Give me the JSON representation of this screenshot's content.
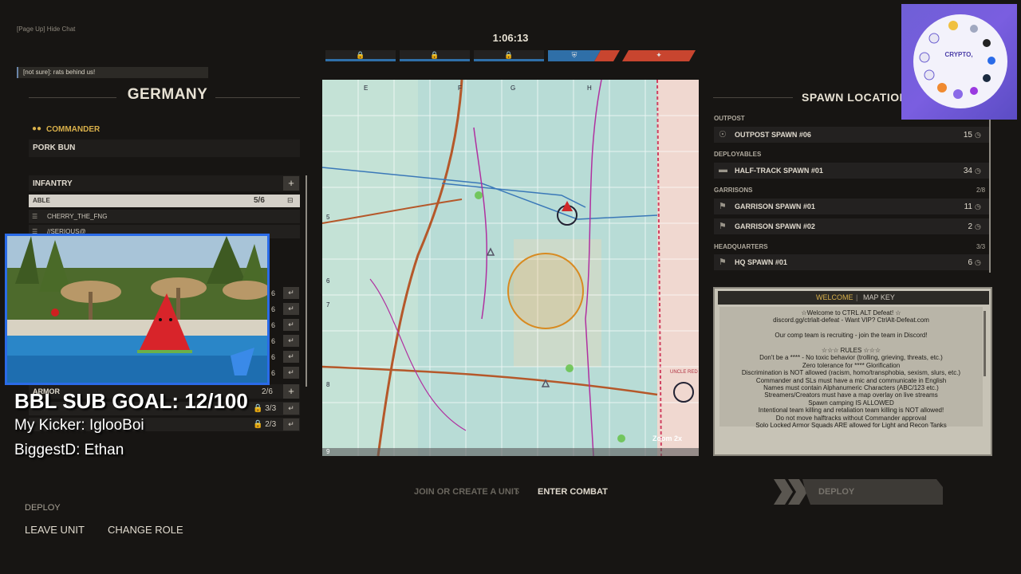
{
  "chat": {
    "hint": "[Page Up] Hide Chat",
    "message": "[not sure]: rats behind us!"
  },
  "timer": "1:06:13",
  "strongpoint_icons": [
    "lock-icon",
    "lock-icon",
    "lock-icon",
    "shield-icon",
    "flash-icon"
  ],
  "colors": {
    "allies": "#2f6fa8",
    "axis": "#c8452f",
    "accent": "#d9b04a",
    "stream_border": "#2a6be8"
  },
  "left_panel": {
    "faction": "GERMANY",
    "commander_label": "COMMANDER",
    "commander_name": "PORK BUN",
    "infantry_label": "INFANTRY",
    "squad": {
      "name": "ABLE",
      "count": "5/6"
    },
    "members": [
      "CHERRY_THE_FNG",
      "//SERIOUS@"
    ],
    "squad_counts": [
      "6",
      "6",
      "6",
      "6",
      "6",
      "6"
    ],
    "armor_label": "ARMOR",
    "armor_count": "2/6",
    "armor_squads": [
      "3/3",
      "2/3"
    ]
  },
  "overlay": {
    "sub_goal": "BBL SUB GOAL: 12/100",
    "kicker": "My Kicker: IglooBoi",
    "biggest": "BiggestD: Ethan"
  },
  "bottom_left": {
    "deploy": "DEPLOY",
    "leave_unit": "LEAVE UNIT",
    "change_role": "CHANGE ROLE"
  },
  "map": {
    "col_labels": [
      "E",
      "F",
      "G",
      "H"
    ],
    "row_labels": [
      "5",
      "6",
      "7",
      "8",
      "9"
    ],
    "place_labels": [
      "UNCLE RED"
    ],
    "zoom": "Zoom 2x"
  },
  "bottom_nav": {
    "step1": "JOIN OR CREATE A UNIT",
    "step2": "ENTER COMBAT",
    "deploy": "DEPLOY"
  },
  "spawns": {
    "title": "SPAWN LOCATIONS",
    "categories": [
      {
        "label": "OUTPOST",
        "count": "",
        "rows": [
          {
            "name": "OUTPOST SPAWN #06",
            "time": "15"
          }
        ]
      },
      {
        "label": "DEPLOYABLES",
        "count": "",
        "rows": [
          {
            "name": "HALF-TRACK SPAWN #01",
            "time": "34"
          }
        ]
      },
      {
        "label": "GARRISONS",
        "count": "2/8",
        "rows": [
          {
            "name": "GARRISON SPAWN #01",
            "time": "11"
          },
          {
            "name": "GARRISON SPAWN #02",
            "time": "2"
          }
        ]
      },
      {
        "label": "HEADQUARTERS",
        "count": "3/3",
        "rows": [
          {
            "name": "HQ SPAWN #01",
            "time": "6"
          }
        ]
      }
    ]
  },
  "info": {
    "tab_welcome": "WELCOME",
    "tab_mapkey": "MAP KEY",
    "lines": [
      "☆Welcome to CTRL ALT Defeat! ☆",
      "discord.gg/ctrlalt-defeat - Want VIP? CtrlAlt-Defeat.com",
      "",
      "Our comp team is recruiting - join the team in Discord!",
      "",
      "☆☆☆ RULES ☆☆☆",
      "Don't be a **** - No toxic behavior (trolling, grieving, threats, etc.)",
      "Zero tolerance for **** Glorification",
      "Discrimination is NOT allowed (racism, homo/transphobia, sexism, slurs, etc.)",
      "Commander and SLs must have a mic and communicate in English",
      "Names must contain Alphanumeric Characters (ABC/123 etc.)",
      "Streamers/Creators must have a map overlay on live streams",
      "Spawn camping IS ALLOWED",
      "Intentional team killing and retaliation team killing is NOT allowed!",
      "Do not move halftracks without Commander approval",
      "Solo Locked Armor Squads ARE allowed for Light and Recon Tanks"
    ]
  },
  "crypto": {
    "label": "CRYPTO,"
  }
}
